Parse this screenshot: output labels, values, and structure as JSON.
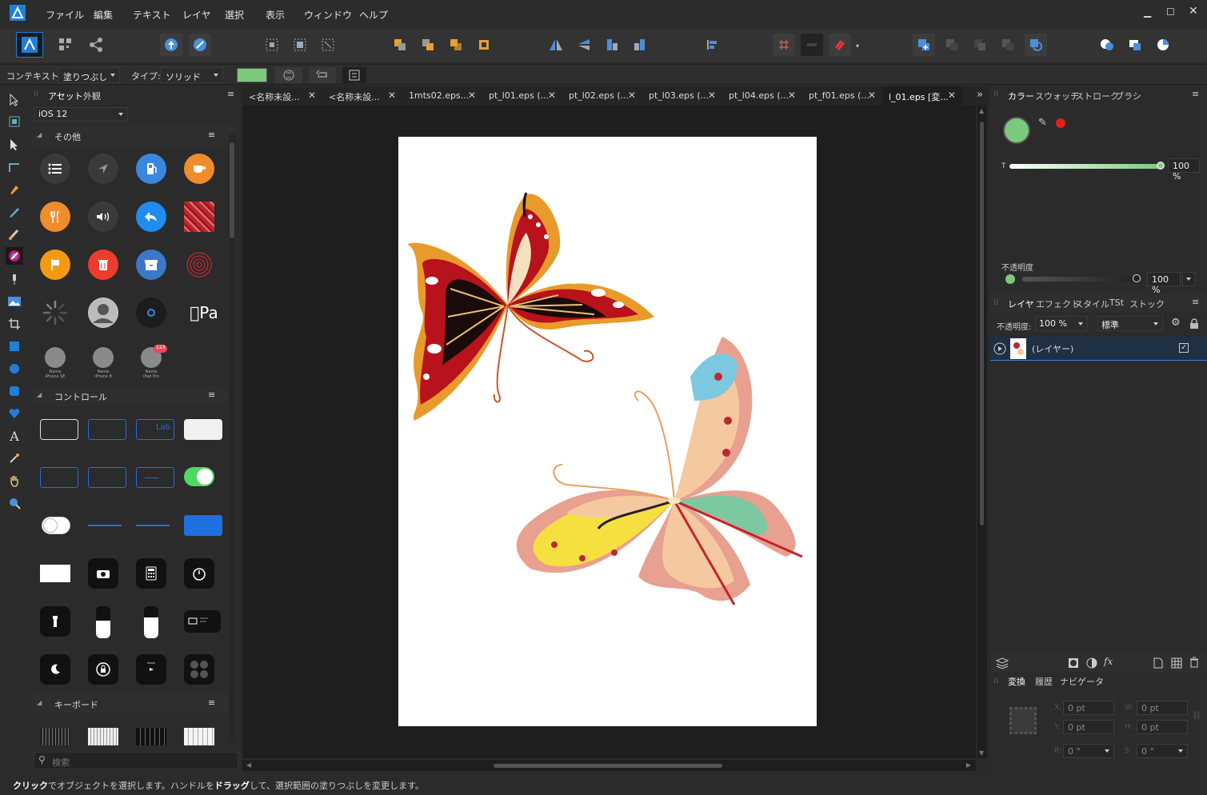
{
  "menu": {
    "items": [
      "ファイル",
      "編集",
      "テキスト",
      "レイヤ",
      "選択",
      "表示",
      "ウィンドウ",
      "ヘルプ"
    ]
  },
  "context": {
    "context_label": "コンテキスト:",
    "context_value": "塗りつぶし",
    "type_label": "タイプ:",
    "type_value": "ソリッド",
    "fill_color": "#7cc97c"
  },
  "assets": {
    "tabs": [
      "アセット",
      "外観"
    ],
    "category": "iOS 12",
    "sections": [
      "その他",
      "コントロール",
      "キーボード"
    ],
    "search_placeholder": "検索",
    "badge": "123",
    "device_labels": [
      "Name\niPhone SE",
      "Name\niPhone 8",
      "Name\niPad Pro"
    ],
    "control_label": "Lab"
  },
  "tabs": [
    "<名称未設...",
    "<名称未設...",
    "1mts02.eps...",
    "pt_l01.eps (...",
    "pt_l02.eps (...",
    "pt_l03.eps (...",
    "pt_l04.eps (...",
    "pt_f01.eps (...",
    "l_01.eps [変..."
  ],
  "color_panel": {
    "tabs": [
      "カラー",
      "スウォッチ",
      "ストローク",
      "ブラシ"
    ],
    "main_color": "#7cc97c",
    "secondary_color": "#e02020",
    "tint_label": "T",
    "tint_value": "100 %",
    "opacity_label": "不透明度",
    "opacity_value": "100 %"
  },
  "layers_panel": {
    "tabs": [
      "レイヤ",
      "エフェクト",
      "スタイル",
      "TSt",
      "ストック"
    ],
    "opacity_label": "不透明度:",
    "opacity_value": "100 %",
    "blend_mode": "標準",
    "layer_name": "(レイヤー)"
  },
  "transform_panel": {
    "tabs": [
      "変換",
      "履歴",
      "ナビゲータ"
    ],
    "x_label": "X:",
    "x_value": "0 pt",
    "y_label": "Y:",
    "y_value": "0 pt",
    "w_label": "W:",
    "w_value": "0 pt",
    "h_label": "H:",
    "h_value": "0 pt",
    "r_label": "R:",
    "r_value": "0 °",
    "s_label": "S:",
    "s_value": "0 °"
  },
  "status": {
    "b1": "クリック",
    "t1": "でオブジェクトを選択します。ハンドルを",
    "b2": "ドラッグ",
    "t2": "して、選択範囲の塗りつぶしを変更します。"
  }
}
